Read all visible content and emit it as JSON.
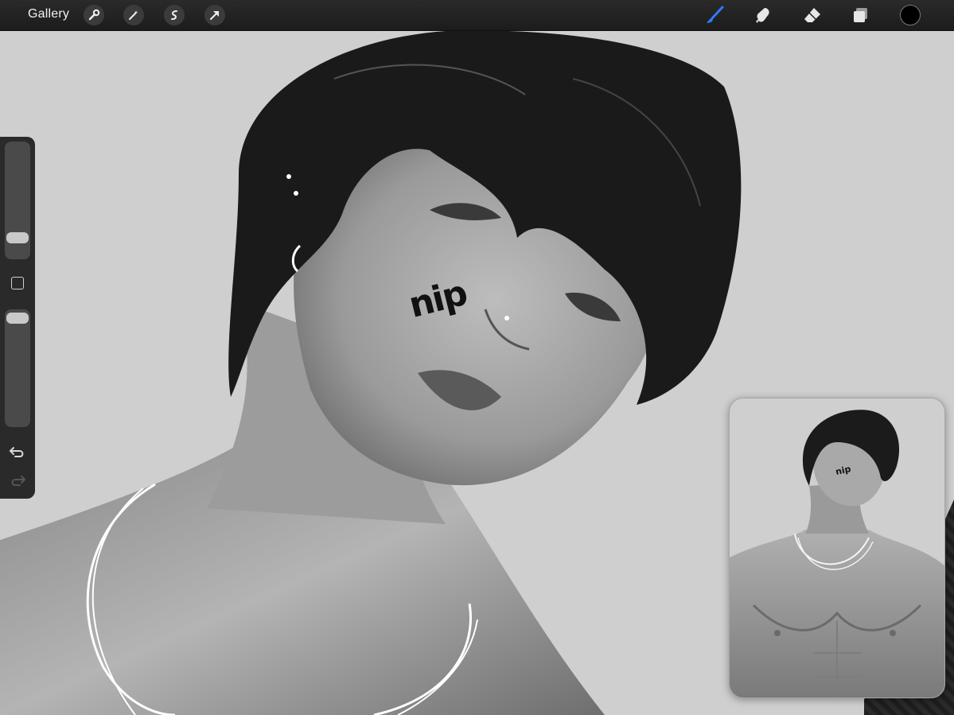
{
  "topbar": {
    "gallery_label": "Gallery",
    "left_tools": [
      "wrench-icon",
      "magic-wand-icon",
      "selection-icon",
      "transform-arrow-icon"
    ],
    "right_tools": [
      "brush-icon",
      "smudge-icon",
      "eraser-icon",
      "layers-icon"
    ],
    "active_tool": "brush-icon",
    "accent_color": "#2f7bff",
    "current_color": "#000000"
  },
  "canvas": {
    "cheek_text": "nip",
    "background_color": "#cfcfcf"
  },
  "sidebar": {
    "brush_size_level": 0.25,
    "opacity_level": 0.93,
    "tools": [
      "modify-square-icon",
      "undo-icon",
      "redo-icon"
    ]
  },
  "reference": {
    "cheek_text": "nip"
  }
}
